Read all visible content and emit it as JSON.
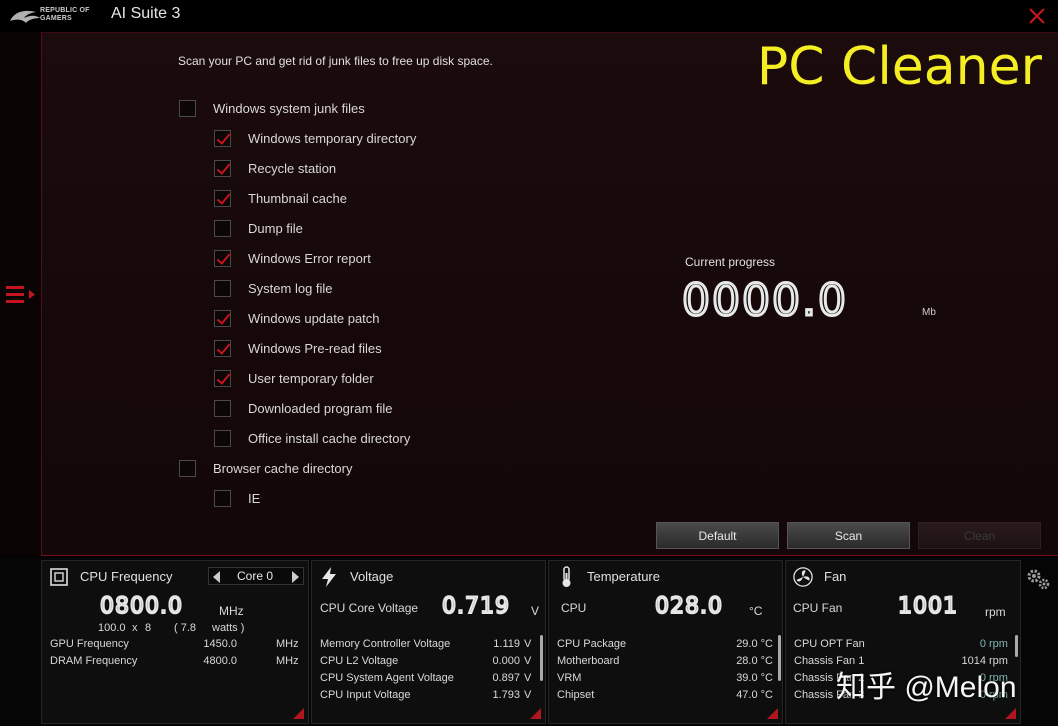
{
  "window": {
    "brand": "REPUBLIC OF GAMERS",
    "title": "AI Suite 3"
  },
  "cleaner": {
    "intro": "Scan your PC and get rid of junk files to free up disk space.",
    "heading": "PC Cleaner",
    "options": [
      {
        "label": "Windows system junk files",
        "checked": false,
        "level": 0
      },
      {
        "label": "Windows temporary directory",
        "checked": true,
        "level": 1
      },
      {
        "label": "Recycle station",
        "checked": true,
        "level": 1
      },
      {
        "label": "Thumbnail cache",
        "checked": true,
        "level": 1
      },
      {
        "label": "Dump file",
        "checked": false,
        "level": 1
      },
      {
        "label": "Windows Error report",
        "checked": true,
        "level": 1
      },
      {
        "label": "System log file",
        "checked": false,
        "level": 1
      },
      {
        "label": "Windows update patch",
        "checked": true,
        "level": 1
      },
      {
        "label": "Windows Pre-read files",
        "checked": true,
        "level": 1
      },
      {
        "label": "User temporary folder",
        "checked": true,
        "level": 1
      },
      {
        "label": "Downloaded program file",
        "checked": false,
        "level": 1
      },
      {
        "label": "Office install cache directory",
        "checked": false,
        "level": 1
      },
      {
        "label": "Browser cache directory",
        "checked": false,
        "level": 0
      },
      {
        "label": "IE",
        "checked": false,
        "level": 1
      }
    ],
    "progress_label": "Current progress",
    "progress_value": "0000.0",
    "progress_unit": "Mb",
    "buttons": {
      "default": "Default",
      "scan": "Scan",
      "clean": "Clean"
    }
  },
  "cpu_frequency": {
    "title": "CPU Frequency",
    "core_selector": "Core 0",
    "value": "0800.0",
    "unit": "MHz",
    "bclk": "100.0",
    "x": "x",
    "ratio": "8",
    "watts_value": "( 7.8",
    "watts_label": "watts )",
    "rows": [
      {
        "label": "GPU Frequency",
        "value": "1450.0",
        "unit": "MHz"
      },
      {
        "label": "DRAM Frequency",
        "value": "4800.0",
        "unit": "MHz"
      }
    ]
  },
  "voltage": {
    "title": "Voltage",
    "main_label": "CPU Core Voltage",
    "main_value": "0.719",
    "main_unit": "V",
    "rows": [
      {
        "label": "Memory Controller Voltage",
        "value": "1.119",
        "unit": "V"
      },
      {
        "label": "CPU L2 Voltage",
        "value": "0.000",
        "unit": "V"
      },
      {
        "label": "CPU System Agent Voltage",
        "value": "0.897",
        "unit": "V"
      },
      {
        "label": "CPU Input Voltage",
        "value": "1.793",
        "unit": "V"
      }
    ]
  },
  "temperature": {
    "title": "Temperature",
    "main_label": "CPU",
    "main_value": "028.0",
    "main_unit": "°C",
    "rows": [
      {
        "label": "CPU Package",
        "value": "29.0 °C"
      },
      {
        "label": "Motherboard",
        "value": "28.0 °C"
      },
      {
        "label": "VRM",
        "value": "39.0 °C"
      },
      {
        "label": "Chipset",
        "value": "47.0 °C"
      }
    ]
  },
  "fan": {
    "title": "Fan",
    "main_label": "CPU Fan",
    "main_value": "1001",
    "main_unit": "rpm",
    "rows": [
      {
        "label": "CPU OPT Fan",
        "value": "0",
        "unit": "rpm",
        "color": "#7fb8b0"
      },
      {
        "label": "Chassis Fan 1",
        "value": "1014",
        "unit": "rpm",
        "color": "#d8d8d8"
      },
      {
        "label": "Chassis Fan 2",
        "value": "0",
        "unit": "rpm",
        "color": "#7fb8b0"
      },
      {
        "label": "Chassis Fan 3",
        "value": "0",
        "unit": "rpm",
        "color": "#7fb8b0"
      }
    ]
  },
  "watermark": "知乎 @Melon",
  "colors": {
    "accent": "#c4141f",
    "heading": "#f4ee22",
    "border": "#7a0f18"
  }
}
